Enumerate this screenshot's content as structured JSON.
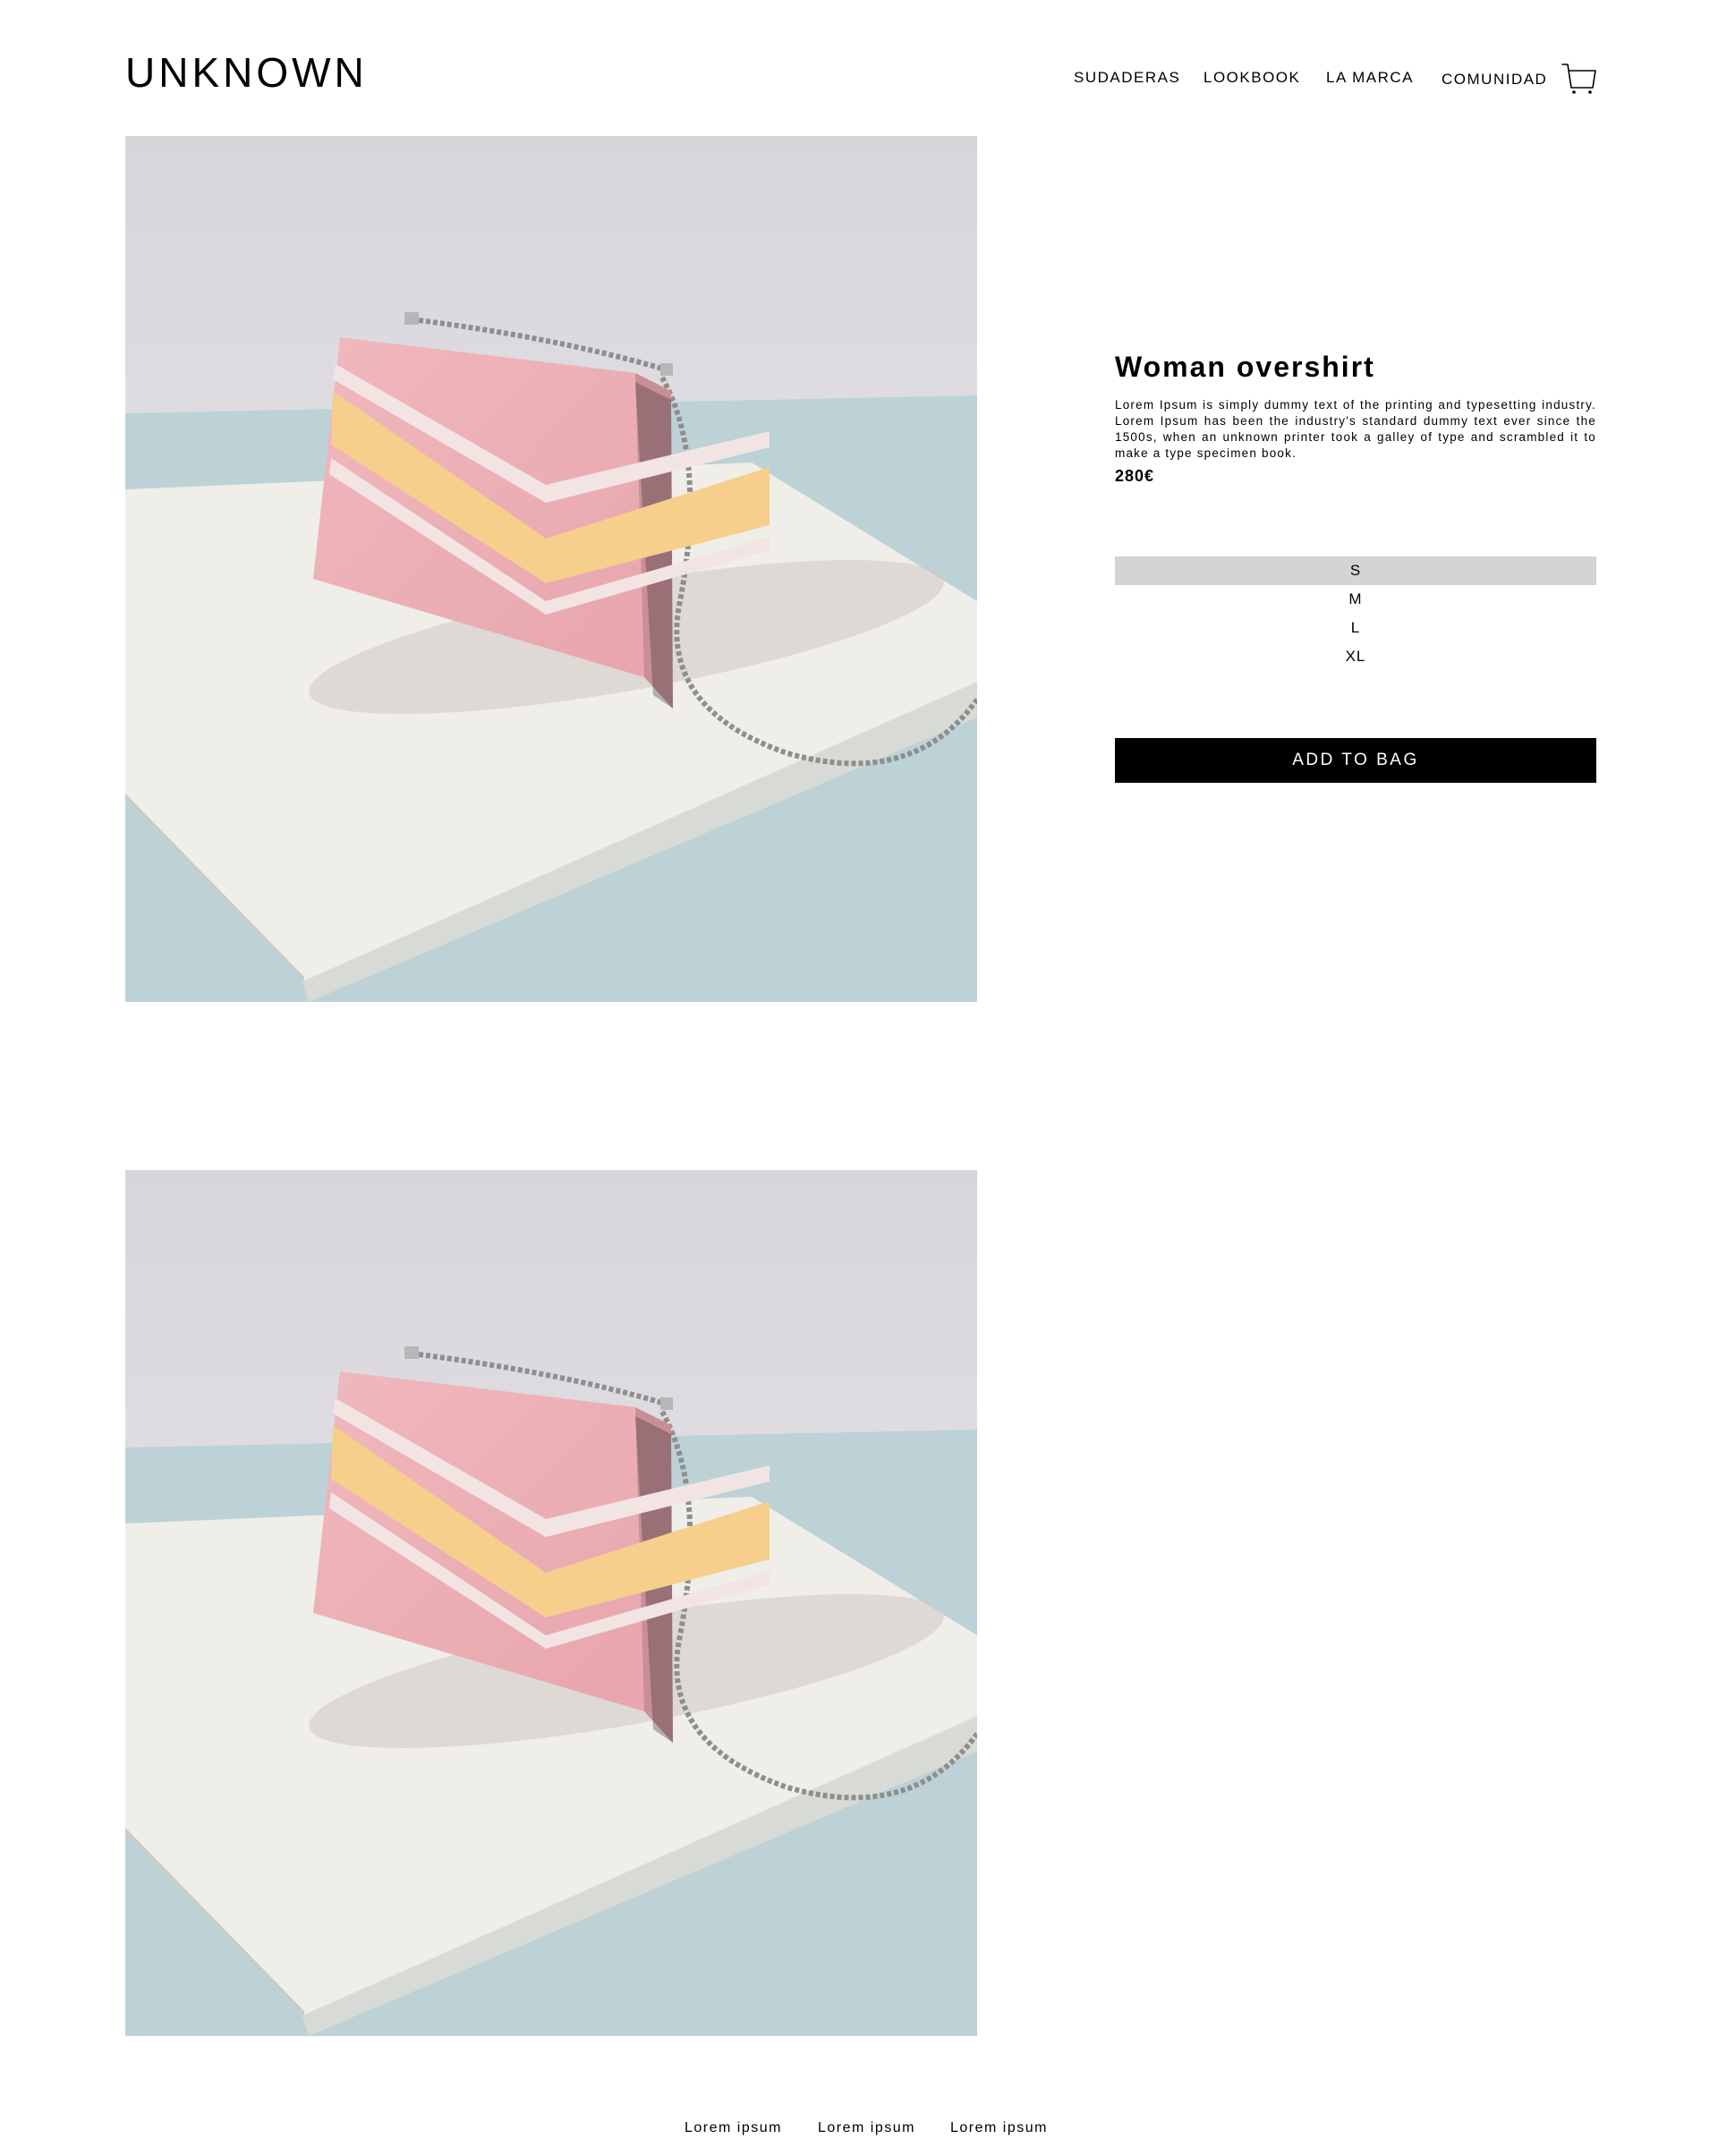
{
  "header": {
    "logo": "UNKNOWN",
    "nav": [
      "SUDADERAS",
      "LOOKBOOK",
      "LA MARCA",
      "COMUNIDAD"
    ],
    "cart_icon": "shopping-cart-icon"
  },
  "product": {
    "title": "Woman overshirt",
    "description": "Lorem Ipsum is simply dummy text of the printing and typesetting industry. Lorem Ipsum has been the industry's standard dummy text ever since the 1500s, when an unknown printer took a galley of type and scrambled it to make a type specimen book.",
    "price": "280€",
    "sizes": [
      "S",
      "M",
      "L",
      "XL"
    ],
    "selected_size": "S",
    "add_to_bag": "ADD TO BAG"
  },
  "footer": {
    "links": [
      "Lorem ipsum",
      "Lorem ipsum",
      "Lorem ipsum"
    ]
  },
  "colors": {
    "accent": "#000000",
    "selected_size_bg": "#d4d4d4",
    "bag_pink": "#eeb3b7",
    "stripe_yellow": "#f6cf8c"
  }
}
